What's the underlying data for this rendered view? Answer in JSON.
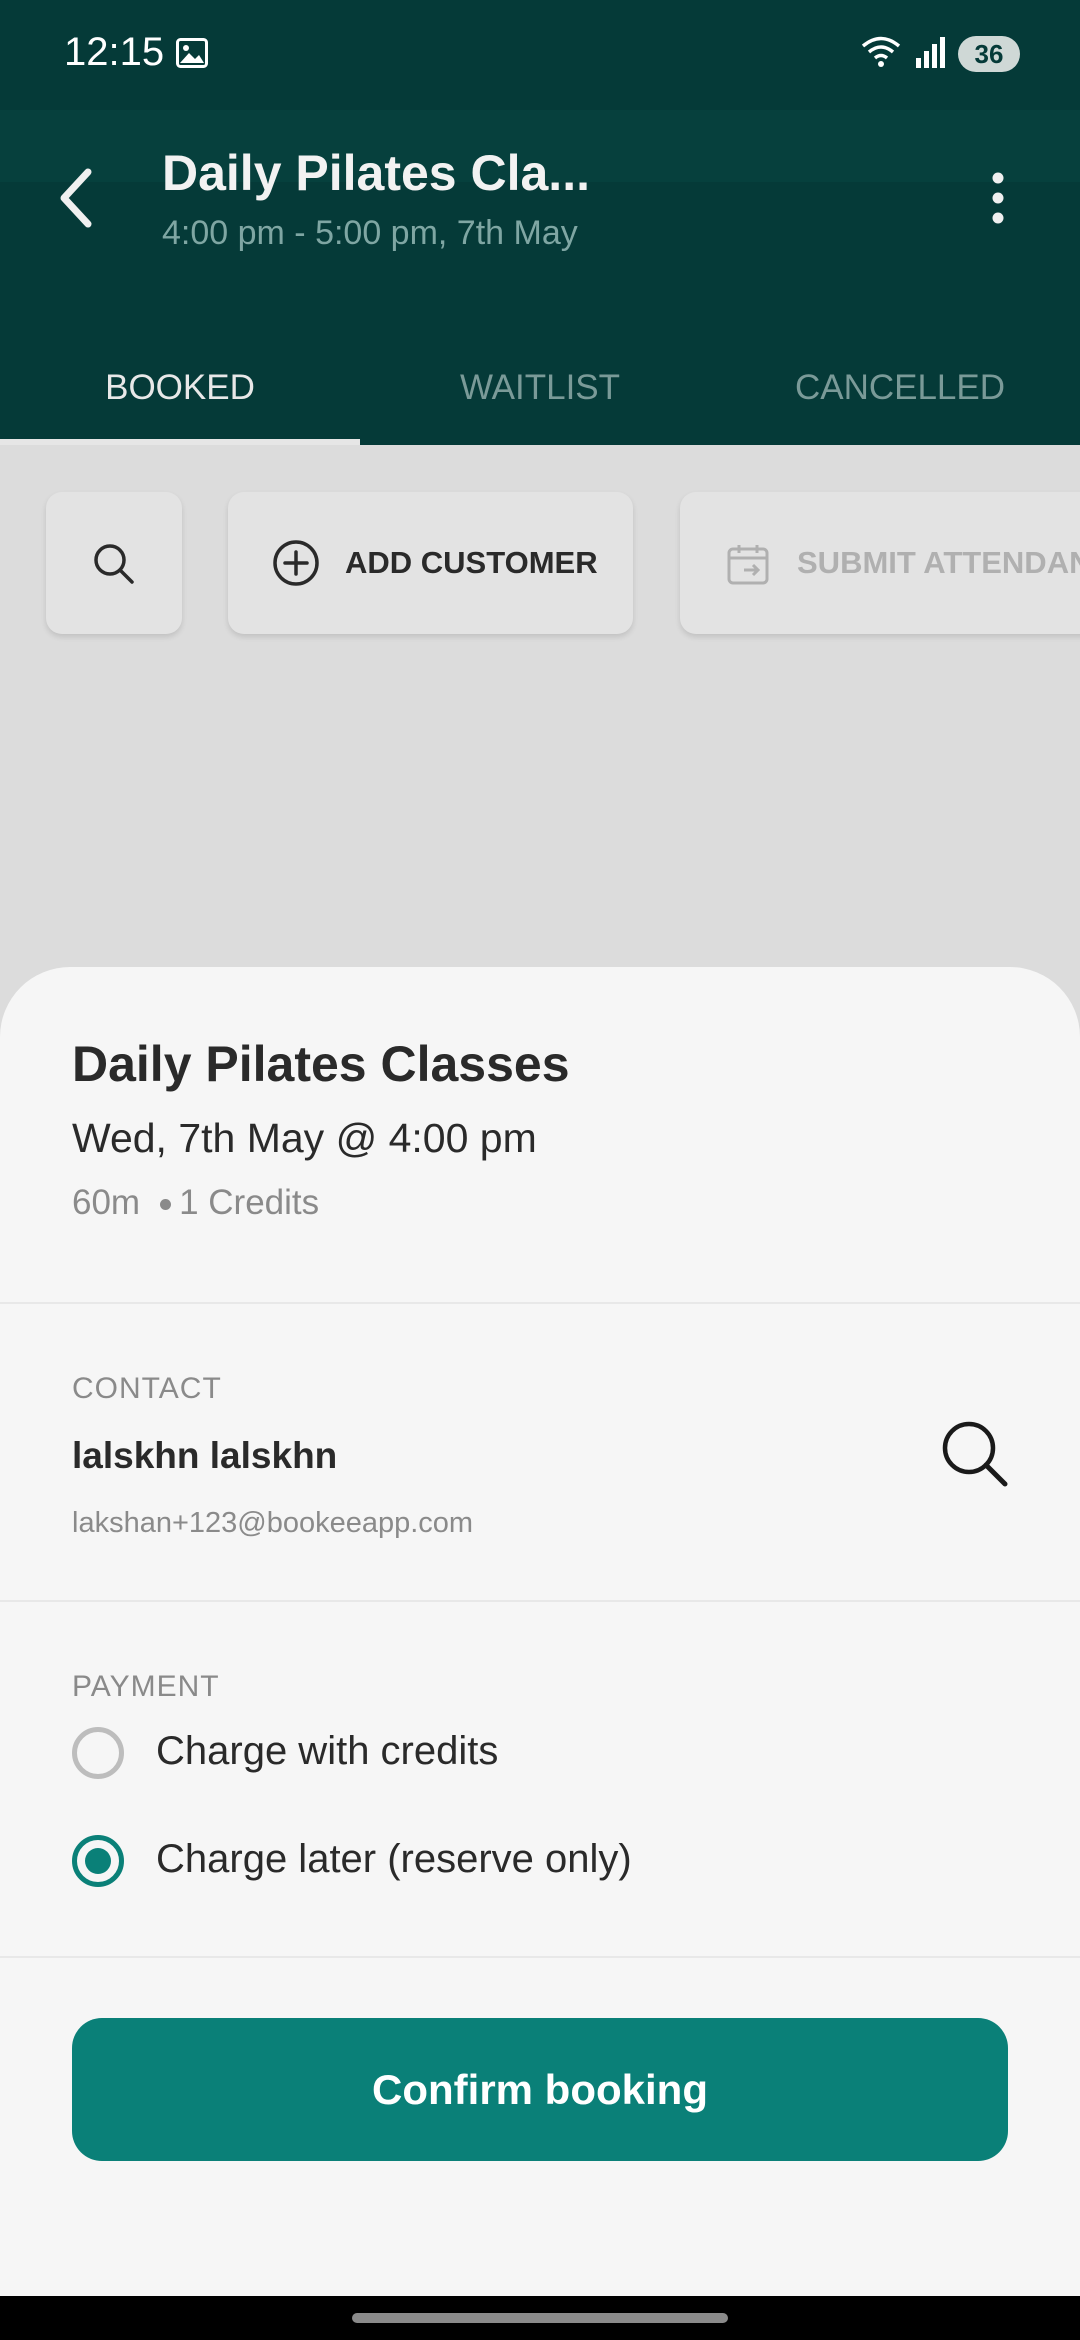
{
  "status_bar": {
    "time": "12:15",
    "battery": "36"
  },
  "header": {
    "title": "Daily Pilates Cla...",
    "subtitle": "4:00 pm - 5:00 pm, 7th May"
  },
  "tabs": [
    {
      "label": "BOOKED",
      "active": true
    },
    {
      "label": "WAITLIST",
      "active": false
    },
    {
      "label": "CANCELLED",
      "active": false
    }
  ],
  "actions": {
    "add_customer": "ADD CUSTOMER",
    "submit_attendance": "SUBMIT ATTENDAN"
  },
  "sheet": {
    "class_name": "Daily Pilates Classes",
    "class_datetime": "Wed, 7th May @ 4:00 pm",
    "duration": "60m",
    "credits": "1 Credits",
    "contact_label": "CONTACT",
    "contact_name": "lalskhn lalskhn",
    "contact_email": "lakshan+123@bookeeapp.com",
    "payment_label": "PAYMENT",
    "payment_options": [
      {
        "label": "Charge with credits",
        "selected": false
      },
      {
        "label": "Charge later (reserve only)",
        "selected": true
      }
    ],
    "confirm_label": "Confirm booking"
  },
  "colors": {
    "header_bg": "#053a38",
    "accent": "#0a8078"
  }
}
